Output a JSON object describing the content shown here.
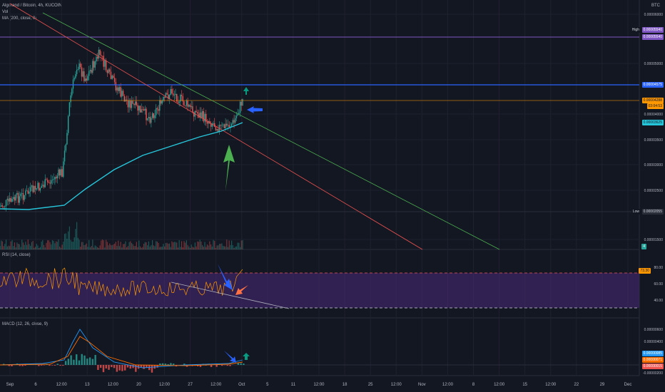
{
  "header": {
    "symbol_title": "Algorand / Bitcoin, 4h, KUCOIN",
    "volume_label": "Vol",
    "ma_label": "MA (200, close, 0)",
    "currency": "BTC"
  },
  "price_axis": {
    "ticks": [
      "0.00006000",
      "0.00005000",
      "0.00004000",
      "0.00003500",
      "0.00003000",
      "0.00002500",
      "0.00001500"
    ],
    "high_label": "High",
    "high_value": "0.00005540",
    "low_label": "Low",
    "low_value": "0.00002055",
    "resistance_value": "0.00004575",
    "last_price": "0.00004288",
    "countdown": "03:04:53",
    "ma_value": "0.00003625",
    "volume_badge": "4"
  },
  "rsi": {
    "label": "RSI (14, close)",
    "value": "73.30",
    "ticks": [
      "80.00",
      "60.00",
      "40.00"
    ]
  },
  "macd": {
    "label": "MACD (12, 26, close, 9)",
    "ticks": [
      "0.00000600",
      "0.00000400",
      "0.00000200",
      "-0.00000200"
    ],
    "value_macd": "0.00000085",
    "value_signal": "0.00000071",
    "value_hist": "0.00000015"
  },
  "time_axis": {
    "labels": [
      "Sep",
      "6",
      "12:00",
      "13",
      "12:00",
      "20",
      "12:00",
      "27",
      "12:00",
      "Oct",
      "5",
      "11",
      "12:00",
      "18",
      "25",
      "12:00",
      "Nov",
      "12:00",
      "8",
      "12:00",
      "15",
      "12:00",
      "22",
      "29",
      "Dec"
    ]
  },
  "colors": {
    "background": "#131722",
    "up": "#26a69a",
    "down": "#ef5350",
    "ma": "#26c6da",
    "resistance": "#2962ff",
    "high_line": "#7e57c2",
    "last_price": "#ff9800",
    "rsi_line": "#ff9800",
    "rsi_band": "#4a2a7a",
    "macd_line": "#2196f3",
    "signal_line": "#ff6d00",
    "arrow_green": "#4caf50",
    "arrow_blue": "#2962ff",
    "arrow_teal": "#089981"
  },
  "icons": [
    "arrow-up-icon",
    "arrow-left-icon",
    "arrow-down-left-icon"
  ]
}
